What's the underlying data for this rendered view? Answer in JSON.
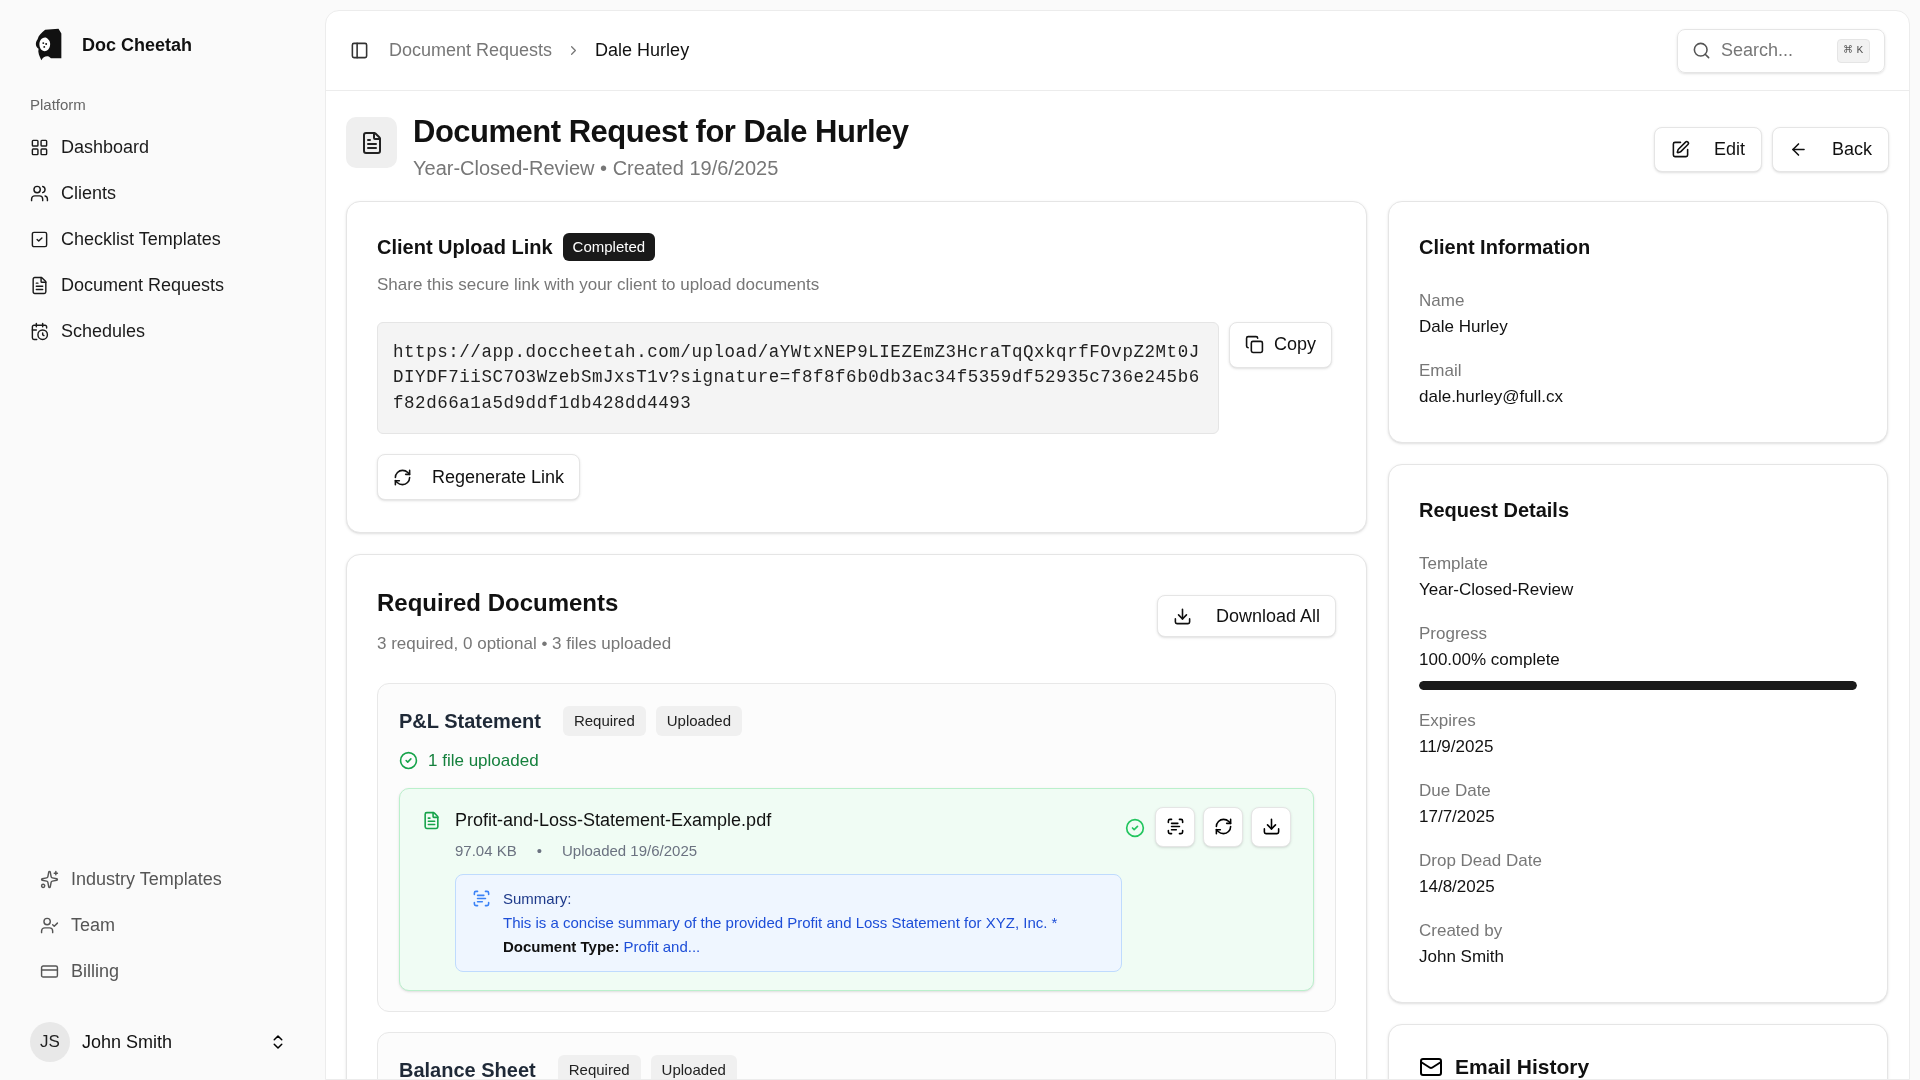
{
  "app": {
    "name": "Doc Cheetah"
  },
  "sidebar": {
    "section_label": "Platform",
    "items": [
      {
        "label": "Dashboard"
      },
      {
        "label": "Clients"
      },
      {
        "label": "Checklist Templates"
      },
      {
        "label": "Document Requests"
      },
      {
        "label": "Schedules"
      }
    ],
    "bottom_items": [
      {
        "label": "Industry Templates"
      },
      {
        "label": "Team"
      },
      {
        "label": "Billing"
      }
    ],
    "user": {
      "initials": "JS",
      "name": "John Smith"
    }
  },
  "breadcrumb": [
    "Document Requests",
    "Dale Hurley"
  ],
  "search": {
    "placeholder": "Search...",
    "shortcut": [
      "⌘",
      "K"
    ]
  },
  "page": {
    "title": "Document Request for Dale Hurley",
    "subtitle": "Year-Closed-Review • Created 19/6/2025",
    "buttons": [
      {
        "label": "Edit"
      },
      {
        "label": "Back"
      }
    ]
  },
  "upload_link": {
    "title": "Client Upload Link",
    "badge": "Completed",
    "description": "Share this secure link with your client to upload documents",
    "url": "https://app.doccheetah.com/upload/aYWtxNEP9LIEZEmZ3HcraTqQxkqrfFOvpZ2Mt0JDIYDF7iiSC7O3WzebSmJxsT1v?signature=f8f8f6b0db3ac34f5359df52935c736e245b6f82d66a1a5d9ddf1db428dd4493",
    "copy_button": "Copy",
    "regenerate_button": "Regenerate Link"
  },
  "required_documents": {
    "title": "Required Documents",
    "summary": "3 required, 0 optional • 3 files uploaded",
    "download_all": "Download All",
    "documents": [
      {
        "name": "P&L Statement",
        "badges": [
          "Required",
          "Uploaded"
        ],
        "status": "1 file uploaded",
        "files": [
          {
            "name": "Profit-and-Loss-Statement-Example.pdf",
            "size": "97.04 KB",
            "separator": "•",
            "uploaded": "Uploaded 19/6/2025",
            "verified": true,
            "summary_label": "Summary:",
            "summary_text": "This is a concise summary of the provided Profit and Loss Statement for XYZ, Inc. *",
            "summary_type": "**Document Type:** Profit and..."
          }
        ]
      },
      {
        "name": "Balance Sheet",
        "badges": [
          "Required",
          "Uploaded"
        ]
      }
    ]
  },
  "client_information": {
    "title": "Client Information",
    "fields": [
      {
        "label": "Name",
        "value": "Dale Hurley"
      },
      {
        "label": "Email",
        "value": "dale.hurley@full.cx"
      }
    ]
  },
  "request_details": {
    "title": "Request Details",
    "fields": [
      {
        "kind": "text",
        "label": "Template",
        "value": "Year-Closed-Review"
      },
      {
        "kind": "progress",
        "label": "Progress",
        "value": "100.00% complete",
        "level": 1
      },
      {
        "kind": "text",
        "label": "Expires",
        "value": "11/9/2025"
      },
      {
        "kind": "text",
        "label": "Due Date",
        "value": "17/7/2025"
      },
      {
        "kind": "text",
        "label": "Drop Dead Date",
        "value": "14/8/2025"
      },
      {
        "kind": "text",
        "label": "Created by",
        "value": "John Smith"
      }
    ]
  },
  "email_history": {
    "title": "Email History"
  }
}
